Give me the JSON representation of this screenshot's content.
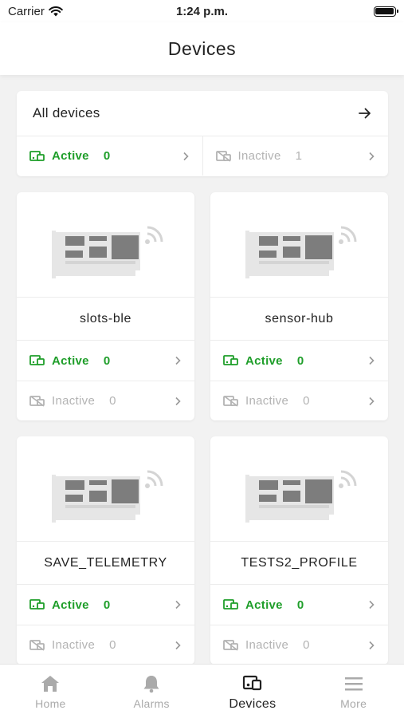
{
  "status_bar": {
    "carrier": "Carrier",
    "time": "1:24 p.m."
  },
  "header": {
    "title": "Devices"
  },
  "all_devices": {
    "title": "All devices",
    "active_label": "Active",
    "active_count": "0",
    "inactive_label": "Inactive",
    "inactive_count": "1"
  },
  "profiles": [
    {
      "name": "slots-ble",
      "active_label": "Active",
      "active_count": "0",
      "inactive_label": "Inactive",
      "inactive_count": "0"
    },
    {
      "name": "sensor-hub",
      "active_label": "Active",
      "active_count": "0",
      "inactive_label": "Inactive",
      "inactive_count": "0"
    },
    {
      "name": "SAVE_TELEMETRY",
      "active_label": "Active",
      "active_count": "0",
      "inactive_label": "Inactive",
      "inactive_count": "0"
    },
    {
      "name": "TESTS2_PROFILE",
      "active_label": "Active",
      "active_count": "0",
      "inactive_label": "Inactive",
      "inactive_count": "0"
    }
  ],
  "tab_bar": {
    "tabs": [
      {
        "label": "Home",
        "icon": "home-icon",
        "selected": false
      },
      {
        "label": "Alarms",
        "icon": "bell-icon",
        "selected": false
      },
      {
        "label": "Devices",
        "icon": "devices-icon",
        "selected": true
      },
      {
        "label": "More",
        "icon": "menu-icon",
        "selected": false
      }
    ]
  },
  "colors": {
    "active": "#1f9e2a",
    "inactive": "#b3b3b3",
    "background": "#f2f2f2"
  }
}
